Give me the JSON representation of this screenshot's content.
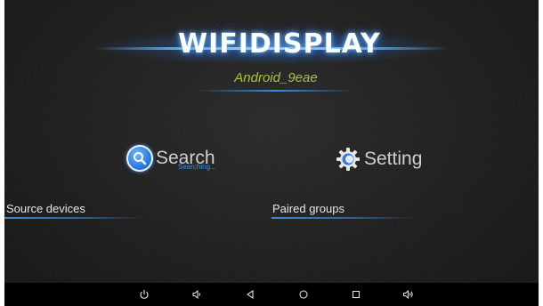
{
  "app": {
    "logo_text": "WIFIDISPLAY",
    "device_name": "Android_9eae"
  },
  "actions": {
    "search_label": "Search",
    "searching_status": "Searching...",
    "setting_label": "Setting"
  },
  "sections": {
    "source_devices": "Source devices",
    "paired_groups": "Paired groups"
  },
  "navbar": {
    "buttons": [
      "power-icon",
      "volume-down-icon",
      "back-icon",
      "home-icon",
      "recents-icon",
      "volume-up-icon"
    ]
  },
  "colors": {
    "accent_blue": "#3d8fe0",
    "device_name_green": "#a9c23a",
    "background": "#1f1f1f"
  }
}
